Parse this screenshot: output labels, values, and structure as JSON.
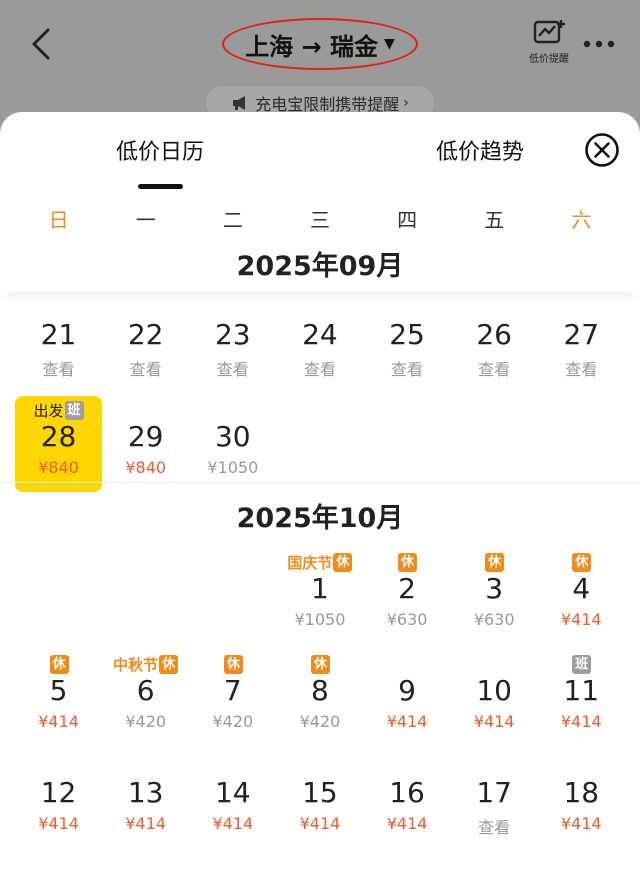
{
  "header": {
    "route": "上海 → 瑞金",
    "price_alert_label": "低价提醒",
    "notice": "充电宝限制携带提醒"
  },
  "tabs": [
    {
      "label": "低价日历",
      "active": true
    },
    {
      "label": "低价趋势",
      "active": false
    }
  ],
  "weekdays": [
    "日",
    "一",
    "二",
    "三",
    "四",
    "五",
    "六"
  ],
  "colors": {
    "accent": "#f08c1a",
    "low_price": "#ee5a2e",
    "selected_bg": "#ffd700"
  },
  "months": [
    {
      "title": "2025年09月",
      "leading_blank": 0,
      "days": [
        {
          "day": "21",
          "price": "查看",
          "low": false
        },
        {
          "day": "22",
          "price": "查看",
          "low": false
        },
        {
          "day": "23",
          "price": "查看",
          "low": false
        },
        {
          "day": "24",
          "price": "查看",
          "low": false
        },
        {
          "day": "25",
          "price": "查看",
          "low": false
        },
        {
          "day": "26",
          "price": "查看",
          "low": false
        },
        {
          "day": "27",
          "price": "查看",
          "low": false
        },
        {
          "day": "28",
          "price": "¥840",
          "low": true,
          "tag": "出发",
          "badge": "班",
          "badge_type": "work",
          "selected": true
        },
        {
          "day": "29",
          "price": "¥840",
          "low": true
        },
        {
          "day": "30",
          "price": "¥1050",
          "low": false
        }
      ]
    },
    {
      "title": "2025年10月",
      "leading_blank": 3,
      "days": [
        {
          "day": "1",
          "price": "¥1050",
          "low": false,
          "tag": "国庆节",
          "badge": "休",
          "badge_type": "rest"
        },
        {
          "day": "2",
          "price": "¥630",
          "low": false,
          "badge": "休",
          "badge_type": "rest"
        },
        {
          "day": "3",
          "price": "¥630",
          "low": false,
          "badge": "休",
          "badge_type": "rest"
        },
        {
          "day": "4",
          "price": "¥414",
          "low": true,
          "badge": "休",
          "badge_type": "rest"
        },
        {
          "day": "5",
          "price": "¥414",
          "low": true,
          "badge": "休",
          "badge_type": "rest"
        },
        {
          "day": "6",
          "price": "¥420",
          "low": false,
          "tag": "中秋节",
          "badge": "休",
          "badge_type": "rest"
        },
        {
          "day": "7",
          "price": "¥420",
          "low": false,
          "badge": "休",
          "badge_type": "rest"
        },
        {
          "day": "8",
          "price": "¥420",
          "low": false,
          "badge": "休",
          "badge_type": "rest"
        },
        {
          "day": "9",
          "price": "¥414",
          "low": true
        },
        {
          "day": "10",
          "price": "¥414",
          "low": true
        },
        {
          "day": "11",
          "price": "¥414",
          "low": true,
          "badge": "班",
          "badge_type": "work"
        },
        {
          "day": "12",
          "price": "¥414",
          "low": true
        },
        {
          "day": "13",
          "price": "¥414",
          "low": true
        },
        {
          "day": "14",
          "price": "¥414",
          "low": true
        },
        {
          "day": "15",
          "price": "¥414",
          "low": true
        },
        {
          "day": "16",
          "price": "¥414",
          "low": true
        },
        {
          "day": "17",
          "price": "查看",
          "low": false
        },
        {
          "day": "18",
          "price": "¥414",
          "low": true
        }
      ]
    }
  ]
}
